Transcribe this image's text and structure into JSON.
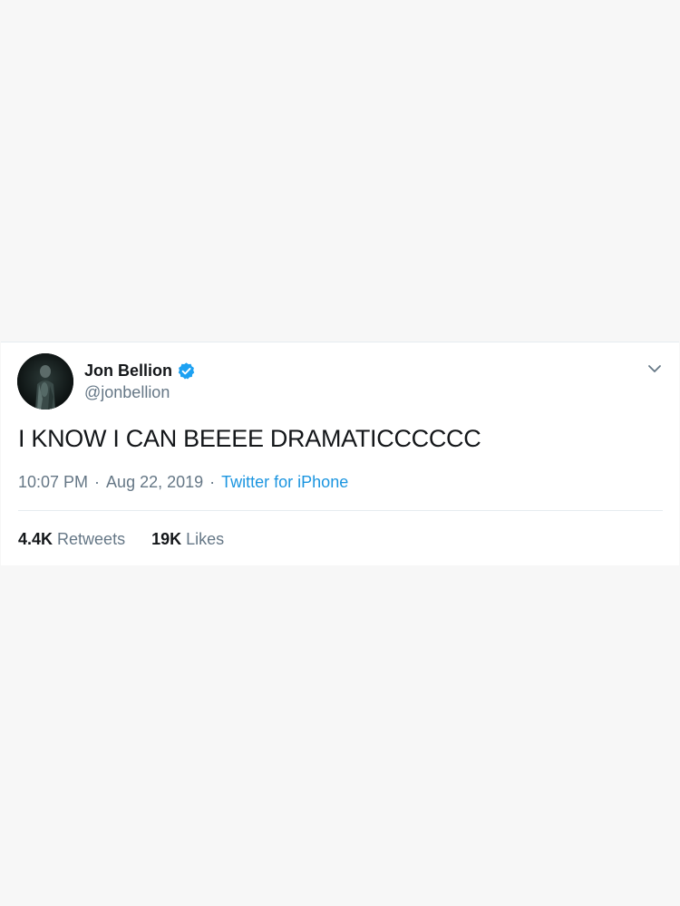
{
  "tweet": {
    "author": {
      "name": "Jon Bellion",
      "handle": "@jonbellion",
      "verified": true,
      "verified_color": "#1da1f2"
    },
    "text": "I KNOW I CAN BEEEE DRAMATICCCCCC",
    "time": "10:07 PM",
    "date": "Aug 22, 2019",
    "source": "Twitter for iPhone",
    "separator": "·",
    "stats": {
      "retweets_count": "4.4K",
      "retweets_label": "Retweets",
      "likes_count": "19K",
      "likes_label": "Likes"
    },
    "menu_icon": "chevron-down-icon"
  },
  "colors": {
    "background": "#f7f7f7",
    "card": "#ffffff",
    "primary_text": "#14171a",
    "secondary_text": "#657786",
    "link": "#1b95e0"
  }
}
